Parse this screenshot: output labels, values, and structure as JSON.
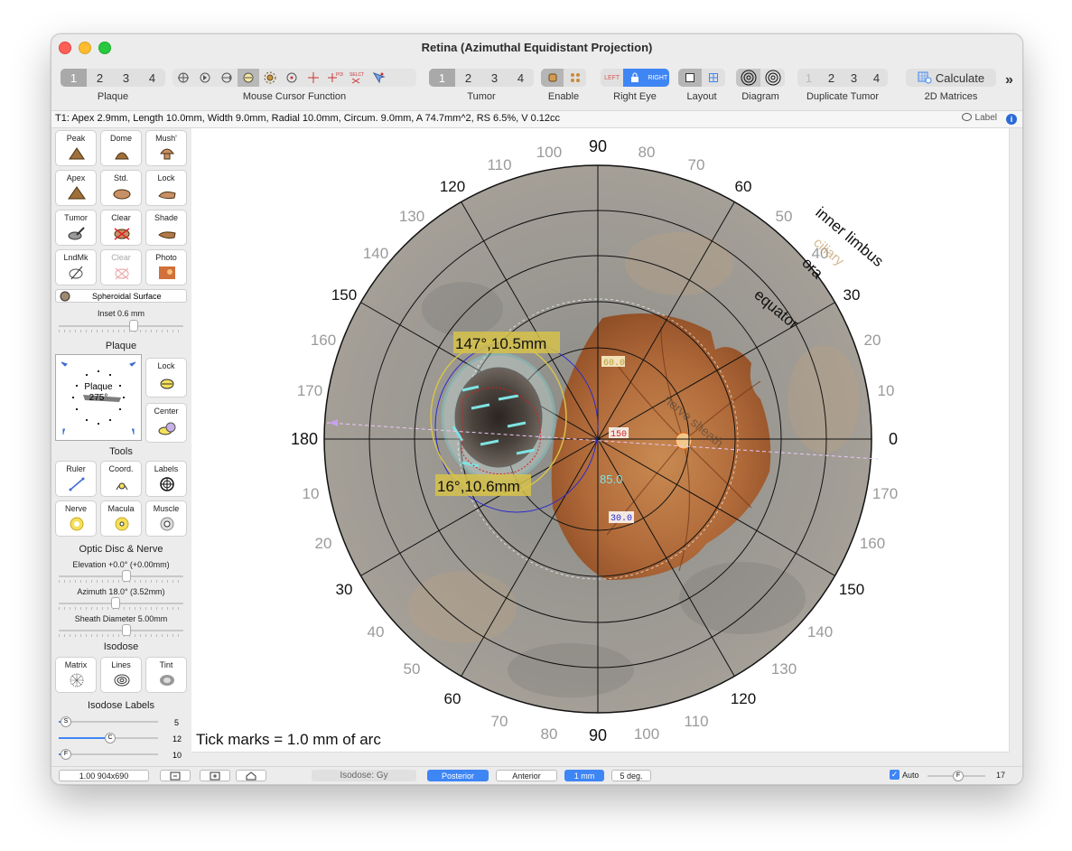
{
  "window": {
    "title": "Retina (Azimuthal Equidistant Projection)"
  },
  "toolbar": {
    "plaque": {
      "label": "Plaque",
      "options": [
        "1",
        "2",
        "3",
        "4"
      ],
      "selected": "1"
    },
    "mouse_cursor": {
      "label": "Mouse Cursor Function",
      "icons": [
        "pan-icon",
        "rotate-icon",
        "move-icon",
        "select-icon",
        "sun-icon",
        "target-icon",
        "crosshair-icon",
        "poi-icon",
        "select-tool-icon",
        "landmark-icon"
      ]
    },
    "tumor": {
      "label": "Tumor",
      "options": [
        "1",
        "2",
        "3",
        "4"
      ],
      "selected": "1"
    },
    "enable": {
      "label": "Enable"
    },
    "eye": {
      "label": "Right Eye",
      "options": [
        "LEFT",
        "",
        "RIGHT"
      ]
    },
    "layout": {
      "label": "Layout"
    },
    "diagram": {
      "label": "Diagram"
    },
    "duplicate": {
      "label": "Duplicate Tumor",
      "options": [
        "1",
        "2",
        "3",
        "4"
      ]
    },
    "calculate": {
      "button": "Calculate",
      "label": "2D Matrices"
    },
    "more": "»"
  },
  "info": {
    "text": "T1: Apex 2.9mm, Length 10.0mm, Width 9.0mm, Radial 10.0mm, Circum. 9.0mm, A 74.7mm^2, RS 6.5%, V 0.12cc",
    "label_button": "Label"
  },
  "sidebar": {
    "shape_buttons": [
      {
        "label": "Peak"
      },
      {
        "label": "Dome"
      },
      {
        "label": "Mush'"
      },
      {
        "label": "Apex"
      },
      {
        "label": "Std."
      },
      {
        "label": "Lock"
      },
      {
        "label": "Tumor"
      },
      {
        "label": "Clear"
      },
      {
        "label": "Shade"
      },
      {
        "label": "LndMk"
      },
      {
        "label": "Clear"
      },
      {
        "label": "Photo"
      }
    ],
    "surface": "Spheroidal Surface",
    "inset": "Inset 0.6 mm",
    "plaque_heading": "Plaque",
    "plaque_widget": {
      "name": "Plaque",
      "angle": "275°"
    },
    "plaque_lock": "Lock",
    "plaque_center": "Center",
    "tools_heading": "Tools",
    "tools": [
      {
        "label": "Ruler"
      },
      {
        "label": "Coord."
      },
      {
        "label": "Labels"
      },
      {
        "label": "Nerve"
      },
      {
        "label": "Macula"
      },
      {
        "label": "Muscle"
      }
    ],
    "optic_heading": "Optic Disc & Nerve",
    "elevation": "Elevation +0.0° (+0.00mm)",
    "azimuth": "Azimuth 18.0° (3.52mm)",
    "sheath": "Sheath Diameter 5.00mm",
    "isodose_heading": "Isodose",
    "isodose_buttons": [
      {
        "label": "Matrix"
      },
      {
        "label": "Lines"
      },
      {
        "label": "Tint"
      }
    ],
    "isodose_labels_heading": "Isodose Labels",
    "label_sliders": [
      {
        "letter": "S",
        "value": "5",
        "level": 0.05
      },
      {
        "letter": "C",
        "value": "12",
        "level": 0.5
      },
      {
        "letter": "F",
        "value": "10",
        "level": 0.05
      }
    ]
  },
  "diagram": {
    "outer_labels": {
      "top": "90",
      "bottom": "90",
      "left": "180",
      "right": "0"
    },
    "left_scale": [
      "100",
      "110",
      "120",
      "130",
      "140",
      "150",
      "160",
      "170",
      "10",
      "20",
      "30",
      "40",
      "50",
      "60",
      "70",
      "80"
    ],
    "right_scale": [
      "80",
      "70",
      "60",
      "50",
      "40",
      "30",
      "20",
      "10",
      "170",
      "160",
      "150",
      "140",
      "130",
      "120",
      "110",
      "100"
    ],
    "ring_labels": [
      "inner limbus",
      "ora",
      "equator"
    ],
    "faint_label": "ciliary",
    "nerve_sheath_label": "nerve sheath",
    "ruler1": "147°,10.5mm",
    "ruler2": "16°,10.6mm",
    "isodose_values": [
      "60.0",
      "150",
      "85.0",
      "30.0"
    ],
    "tick_caption": "Tick marks = 1.0 mm of arc"
  },
  "bottombar": {
    "zoom": "1.00 904x690",
    "isodose_units": "Isodose: Gy",
    "posterior": "Posterior",
    "anterior": "Anterior",
    "mm": "1 mm",
    "deg": "5 deg.",
    "auto": "Auto",
    "auto_slider": {
      "letter": "F",
      "value": "17"
    }
  },
  "colors": {
    "accent": "#3f86f5",
    "ruler_fill": "#d6c24a",
    "isodose_cyan": "#7fe3e3",
    "isodose_blue": "#2a2ad0"
  }
}
